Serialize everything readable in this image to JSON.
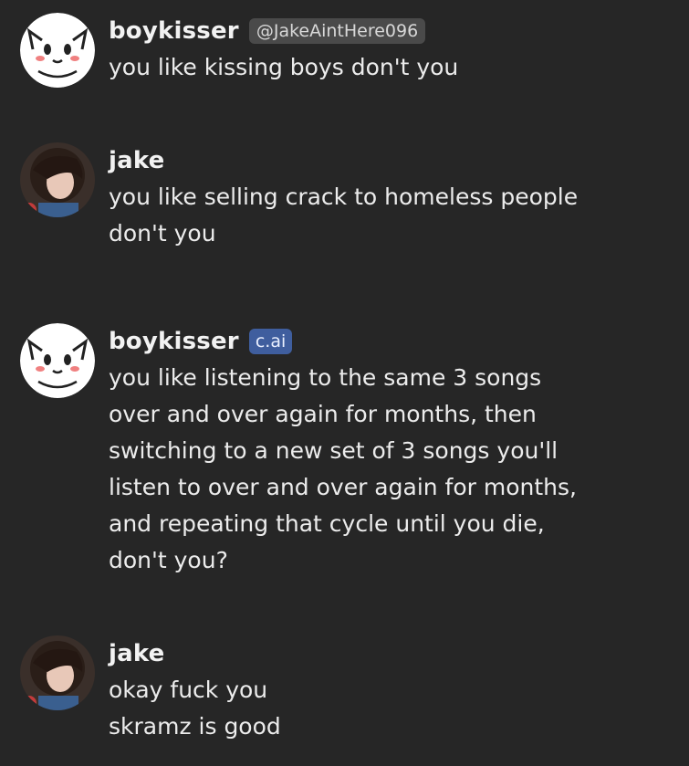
{
  "messages": [
    {
      "author": "boykisser",
      "tag": "@JakeAintHere096",
      "tag_kind": "handle",
      "avatar": "boykisser-cartoon-avatar",
      "text": "you like kissing boys don't you"
    },
    {
      "author": "jake",
      "avatar": "jake-photo-avatar",
      "text": "you like selling crack to homeless people\ndon't you"
    },
    {
      "author": "boykisser",
      "tag": "c.ai",
      "tag_kind": "cai",
      "avatar": "boykisser-cartoon-avatar",
      "text": "you like listening to the same 3 songs\nover and over again for months, then\nswitching to a new set of 3 songs you'll\nlisten to over and over again for months,\nand repeating that cycle until you die,\ndon't you?"
    },
    {
      "author": "jake",
      "avatar": "jake-photo-avatar",
      "text": "okay fuck you\nskramz is good"
    }
  ],
  "colors": {
    "background": "#262626",
    "cai_badge": "#3f5e9e",
    "handle_badge": "#4a4a4a"
  }
}
